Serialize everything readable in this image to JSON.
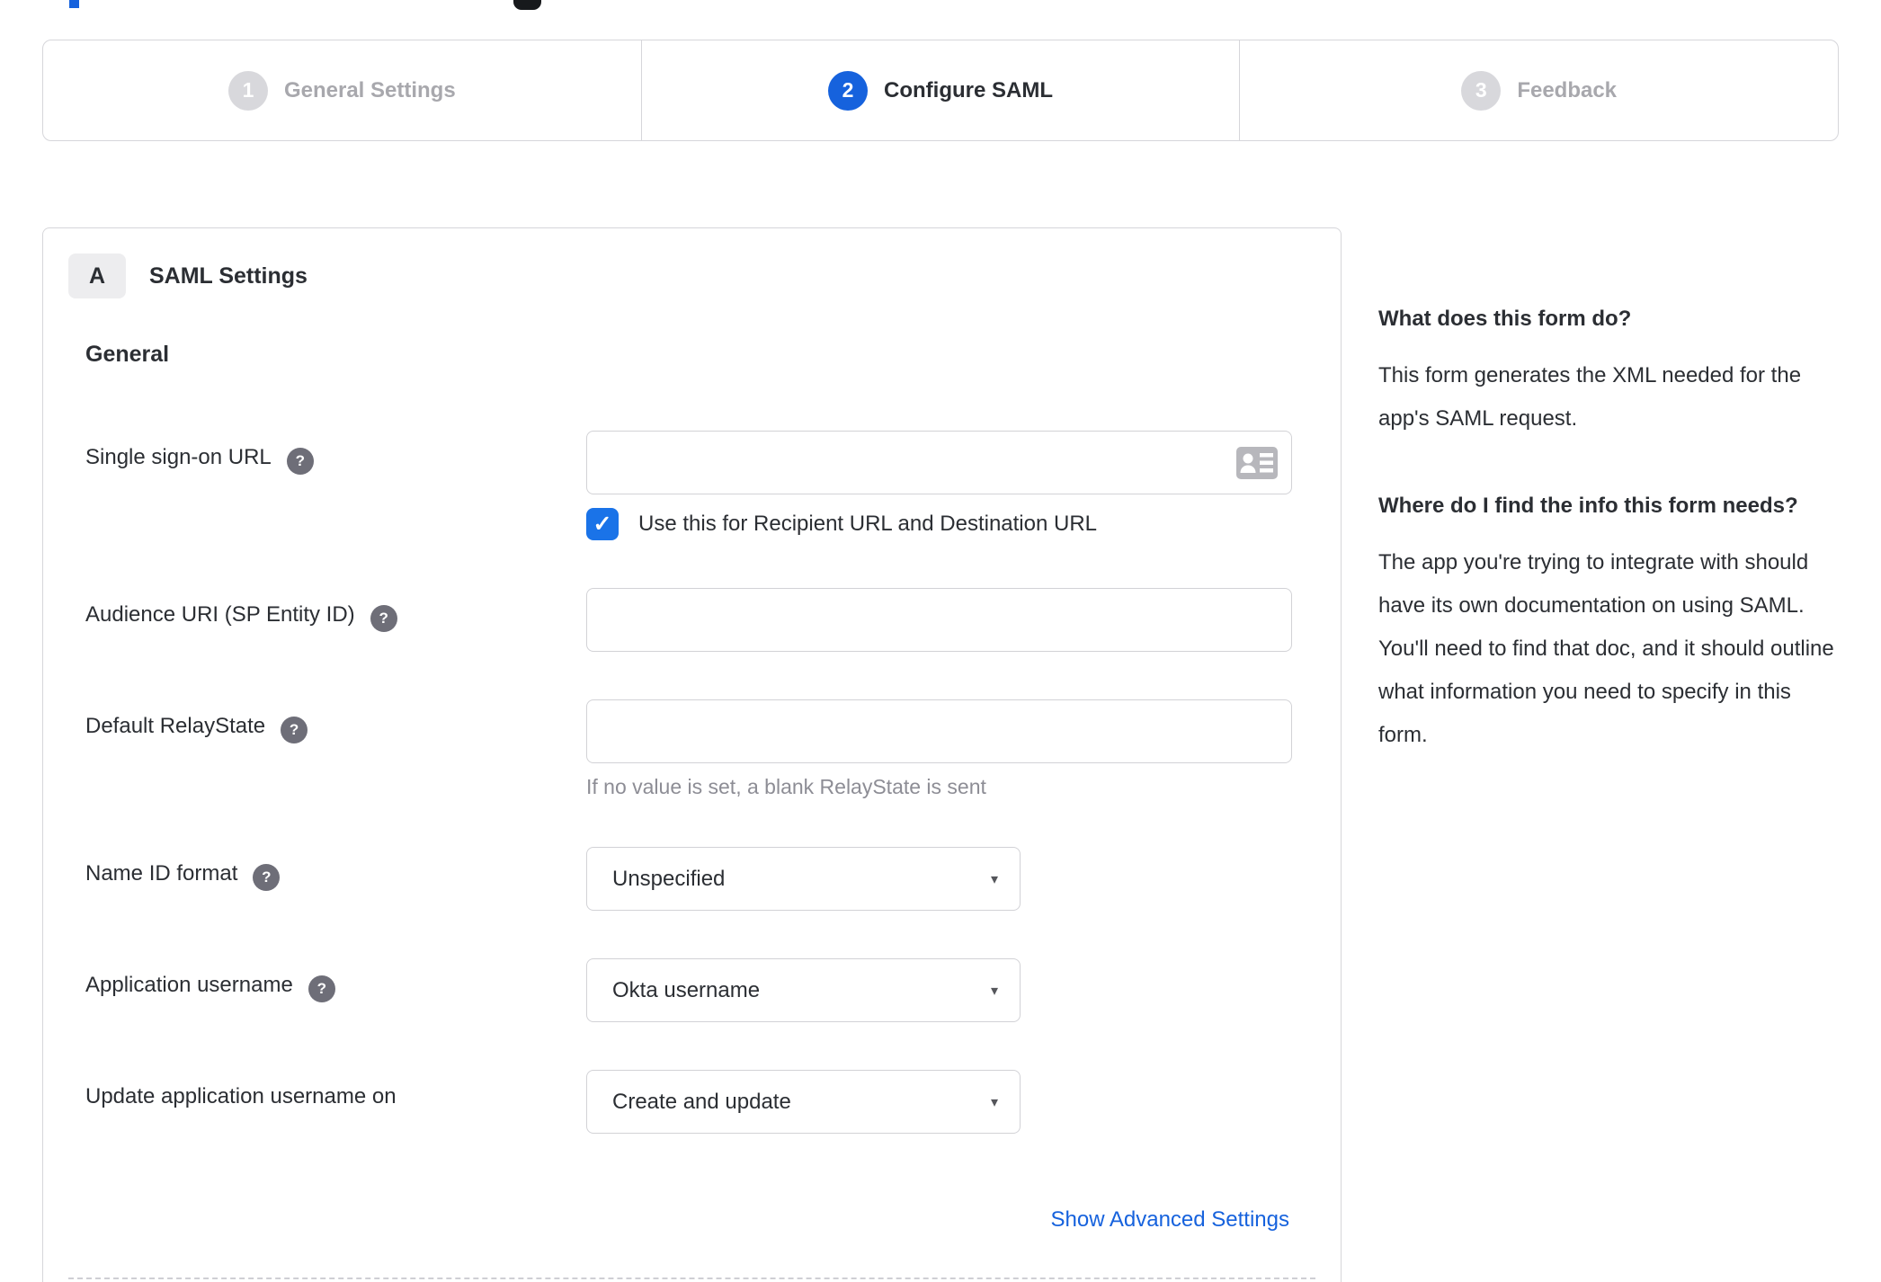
{
  "colors": {
    "accent_blue": "#1662dd",
    "checkbox_blue": "#1a73e8",
    "inactive_gray": "#a8a8ad",
    "border_gray": "#d6d6da",
    "hint_gray": "#8d8d95"
  },
  "icons": {
    "help_glyph": "?",
    "check_glyph": "✓",
    "select_arrow_glyph": "▾"
  },
  "stepper": {
    "steps": [
      {
        "number": "1",
        "label": "General Settings",
        "state": "inactive"
      },
      {
        "number": "2",
        "label": "Configure SAML",
        "state": "active"
      },
      {
        "number": "3",
        "label": "Feedback",
        "state": "inactive"
      }
    ]
  },
  "panel": {
    "section_badge": "A",
    "section_title": "SAML Settings",
    "group_title": "General",
    "fields": [
      {
        "label": "Single sign-on URL",
        "has_help": true,
        "type": "text",
        "value": "",
        "trailing_icon": "contact-card",
        "checkbox": {
          "checked": true,
          "label": "Use this for Recipient URL and Destination URL"
        }
      },
      {
        "label": "Audience URI (SP Entity ID)",
        "has_help": true,
        "type": "text",
        "value": ""
      },
      {
        "label": "Default RelayState",
        "has_help": true,
        "type": "text",
        "value": "",
        "hint": "If no value is set, a blank RelayState is sent"
      },
      {
        "label": "Name ID format",
        "has_help": true,
        "type": "select",
        "value": "Unspecified"
      },
      {
        "label": "Application username",
        "has_help": true,
        "type": "select",
        "value": "Okta username"
      },
      {
        "label": "Update application username on",
        "has_help": false,
        "type": "select",
        "value": "Create and update"
      }
    ],
    "advanced_link": "Show Advanced Settings"
  },
  "sidebar": {
    "sections": [
      {
        "heading": "What does this form do?",
        "body": "This form generates the XML needed for the app's SAML request."
      },
      {
        "heading": "Where do I find the info this form needs?",
        "body": "The app you're trying to integrate with should have its own documentation on using SAML. You'll need to find that doc, and it should outline what information you need to specify in this form."
      }
    ]
  }
}
